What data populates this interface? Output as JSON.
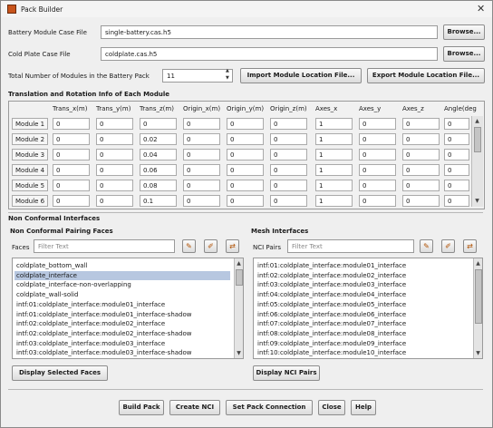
{
  "window": {
    "title": "Pack Builder"
  },
  "files": {
    "battery_label": "Battery Module Case File",
    "battery_value": "single-battery.cas.h5",
    "coldplate_label": "Cold Plate Case File",
    "coldplate_value": "coldplate.cas.h5",
    "browse_label": "Browse..."
  },
  "modules": {
    "count_label": "Total Number of Modules in the Battery Pack",
    "count_value": "11",
    "import_label": "Import Module Location File...",
    "export_label": "Export Module Location File..."
  },
  "translation": {
    "title": "Translation and Rotation Info of Each Module",
    "columns": [
      "Trans_x(m)",
      "Trans_y(m)",
      "Trans_z(m)",
      "Origin_x(m)",
      "Origin_y(m)",
      "Origin_z(m)",
      "Axes_x",
      "Axes_y",
      "Axes_z",
      "Angle(deg"
    ],
    "rows": [
      {
        "name": "Module 1",
        "values": [
          "0",
          "0",
          "0",
          "0",
          "0",
          "0",
          "1",
          "0",
          "0",
          "0"
        ]
      },
      {
        "name": "Module 2",
        "values": [
          "0",
          "0",
          "0.02",
          "0",
          "0",
          "0",
          "1",
          "0",
          "0",
          "0"
        ]
      },
      {
        "name": "Module 3",
        "values": [
          "0",
          "0",
          "0.04",
          "0",
          "0",
          "0",
          "1",
          "0",
          "0",
          "0"
        ]
      },
      {
        "name": "Module 4",
        "values": [
          "0",
          "0",
          "0.06",
          "0",
          "0",
          "0",
          "1",
          "0",
          "0",
          "0"
        ]
      },
      {
        "name": "Module 5",
        "values": [
          "0",
          "0",
          "0.08",
          "0",
          "0",
          "0",
          "1",
          "0",
          "0",
          "0"
        ]
      },
      {
        "name": "Module 6",
        "values": [
          "0",
          "0",
          "0.1",
          "0",
          "0",
          "0",
          "1",
          "0",
          "0",
          "0"
        ]
      }
    ]
  },
  "nonconformal": {
    "title": "Non Conformal Interfaces",
    "pairing_title": "Non Conformal Pairing Faces",
    "faces_label": "Faces",
    "filter_placeholder": "Filter Text",
    "faces": [
      "coldplate_bottom_wall",
      "coldplate_interface",
      "coldplate_interface-non-overlapping",
      "coldplate_wall-solid",
      "intf:01:coldplate_interface:module01_interface",
      "intf:01:coldplate_interface:module01_interface-shadow",
      "intf:02:coldplate_interface:module02_interface",
      "intf:02:coldplate_interface:module02_interface-shadow",
      "intf:03:coldplate_interface:module03_interface",
      "intf:03:coldplate_interface:module03_interface-shadow"
    ],
    "selected_index": 1,
    "display_faces_label": "Display Selected Faces",
    "mesh_title": "Mesh Interfaces",
    "nci_label": "NCI Pairs",
    "nci_pairs": [
      "intf:01:coldplate_interface:module01_interface",
      "intf:02:coldplate_interface:module02_interface",
      "intf:03:coldplate_interface:module03_interface",
      "intf:04:coldplate_interface:module04_interface",
      "intf:05:coldplate_interface:module05_interface",
      "intf:06:coldplate_interface:module06_interface",
      "intf:07:coldplate_interface:module07_interface",
      "intf:08:coldplate_interface:module08_interface",
      "intf:09:coldplate_interface:module09_interface",
      "intf:10:coldplate_interface:module10_interface"
    ],
    "display_nci_label": "Display NCI Pairs"
  },
  "footer": {
    "build": "Build Pack",
    "create_nci": "Create NCI",
    "set_connection": "Set Pack Connection",
    "close": "Close",
    "help": "Help"
  }
}
